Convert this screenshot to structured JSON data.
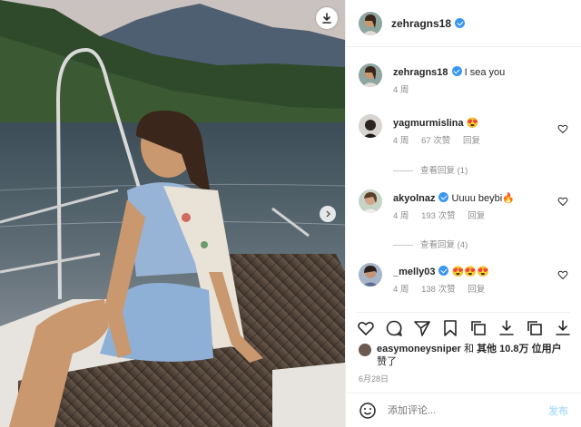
{
  "post": {
    "username": "zehragns18",
    "caption": "I sea you",
    "caption_age": "4 周"
  },
  "comments": [
    {
      "username": "yagmurmislina",
      "text": "😍",
      "age": "4 周",
      "likes": "67 次赞",
      "reply": "回复",
      "view_replies": ""
    },
    {
      "username": "akyolnaz",
      "text": "Uuuu beybi🔥",
      "age": "4 周",
      "likes": "193 次赞",
      "reply": "回复",
      "view_replies": ""
    },
    {
      "username": "_melly03",
      "text": "😍😍😍",
      "age": "4 周",
      "likes": "138 次赞",
      "reply": "回复",
      "view_replies": ""
    }
  ],
  "view_replies_1": "查看回复 (1)",
  "view_replies_2": "查看回复 (4)",
  "likes_line": {
    "user": "easymoneysniper",
    "and": " 和 ",
    "others": "其他 10.8万 位用户",
    "suffix": "赞了"
  },
  "date": "6月28日",
  "add_comment": {
    "placeholder": "添加评论...",
    "post_label": "发布"
  },
  "colors": {
    "accent": "#3897f0",
    "text": "#262626",
    "muted": "#8e8e8e"
  }
}
